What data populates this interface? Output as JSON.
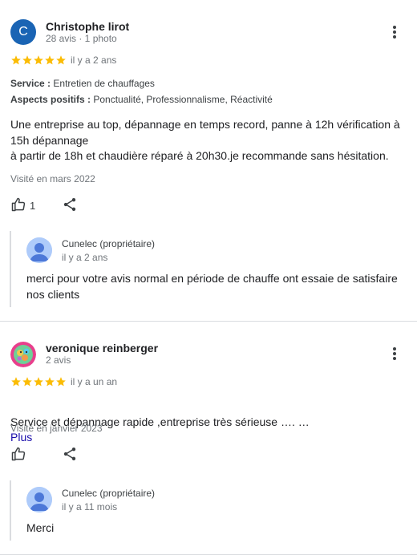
{
  "reviews": [
    {
      "avatar_letter": "C",
      "avatar_color": "#1a64b4",
      "name": "Christophe lirot",
      "meta": "28 avis · 1 photo",
      "rating": 5,
      "date": "il y a 2 ans",
      "service_label": "Service :",
      "service_value": "Entretien de chauffages",
      "aspects_label": "Aspects positifs :",
      "aspects_value": "Ponctualité, Professionnalisme, Réactivité",
      "text": "Une entreprise au top, dépannage en temps record, panne à 12h vérification à 15h dépannage\nà partir de 18h et chaudière réparé à 20h30.je recommande sans hésitation.",
      "visited": "Visité en mars 2022",
      "likes": "1",
      "reply": {
        "owner": "Cunelec (propriétaire)",
        "date": "il y a 2 ans",
        "text": "merci pour votre avis normal en période de chauffe ont essaie de satisfaire nos clients"
      }
    },
    {
      "avatar_icon": "cartoon-avatar-icon",
      "name": "veronique reinberger",
      "meta": "2 avis",
      "rating": 5,
      "date": "il y a un an",
      "text": "Service et dépannage rapide ,entreprise très sérieuse …. …",
      "more_link": "Plus",
      "visited": "Visité en janvier 2023",
      "reply": {
        "owner": "Cunelec (propriétaire)",
        "date": "il y a 11 mois",
        "text": "Merci"
      }
    }
  ],
  "colors": {
    "star": "#fbbc04",
    "link": "#1a0dab",
    "divider": "#dadce0"
  }
}
